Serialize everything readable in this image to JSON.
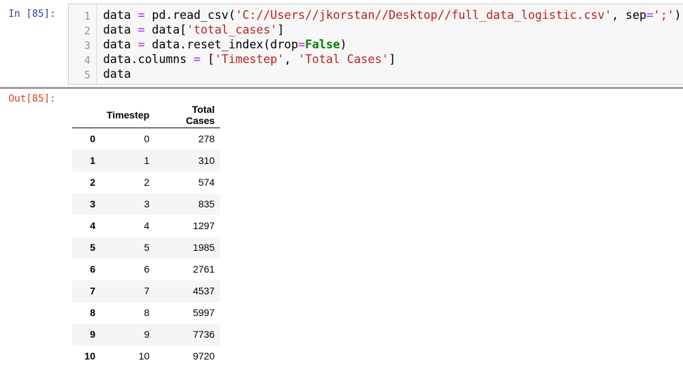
{
  "input_prompt": "In [85]:",
  "output_prompt": "Out[85]:",
  "code": {
    "line_numbers": [
      "1",
      "2",
      "3",
      "4",
      "5"
    ],
    "line1": {
      "a": "data ",
      "op1": "=",
      "b": " pd.read_csv(",
      "s1": "'C://Users//jkorstan//Desktop//full_data_logistic.csv'",
      "c": ", sep",
      "op2": "=",
      "s2": "';'",
      "d": ")"
    },
    "line2": {
      "a": "data ",
      "op1": "=",
      "b": " data[",
      "s1": "'total_cases'",
      "c": "]"
    },
    "line3": {
      "a": "data ",
      "op1": "=",
      "b": " data.reset_index(drop",
      "op2": "=",
      "kw": "False",
      "c": ")"
    },
    "line4": {
      "a": "data.columns ",
      "op1": "=",
      "b": " [",
      "s1": "'Timestep'",
      "c": ", ",
      "s2": "'Total Cases'",
      "d": "]"
    },
    "line5": {
      "a": "data"
    }
  },
  "dataframe": {
    "columns": [
      "",
      "Timestep",
      "Total Cases"
    ],
    "rows": [
      [
        "0",
        "0",
        "278"
      ],
      [
        "1",
        "1",
        "310"
      ],
      [
        "2",
        "2",
        "574"
      ],
      [
        "3",
        "3",
        "835"
      ],
      [
        "4",
        "4",
        "1297"
      ],
      [
        "5",
        "5",
        "1985"
      ],
      [
        "6",
        "6",
        "2761"
      ],
      [
        "7",
        "7",
        "4537"
      ],
      [
        "8",
        "8",
        "5997"
      ],
      [
        "9",
        "9",
        "7736"
      ],
      [
        "10",
        "10",
        "9720"
      ]
    ]
  },
  "colors": {
    "input_prompt": "#303f9f",
    "output_prompt": "#d84315",
    "string": "#ba2121",
    "keyword": "#008000",
    "operator": "#aa22ff",
    "code_bg": "#f7f7f7",
    "stripe": "#f5f5f5"
  }
}
